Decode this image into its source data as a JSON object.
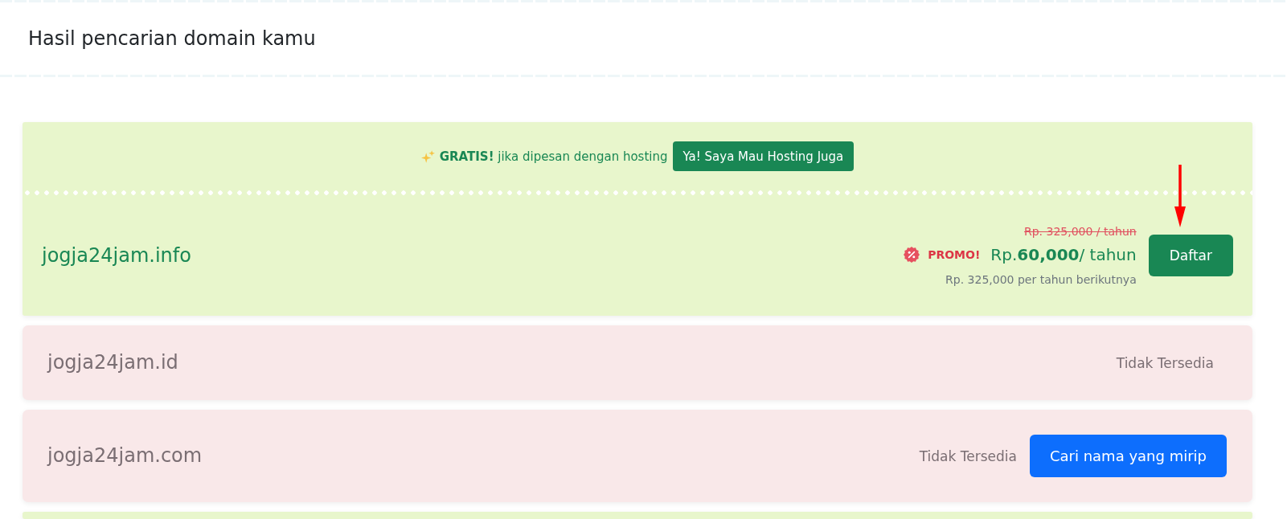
{
  "header": {
    "title": "Hasil pencarian domain kamu"
  },
  "results": [
    {
      "kind": "available",
      "promo": {
        "text": "**GRATIS!** jika dipesan dengan hosting",
        "button": "Ya! Saya Mau Hosting Juga"
      },
      "domain": "jogja24jam.info",
      "price": {
        "original": "Rp. 325,000 / tahun",
        "badge": "PROMO!",
        "current": "Rp.**60,000**/ tahun",
        "renewal": "Rp. 325,000 per tahun berikutnya"
      },
      "button": "Daftar"
    },
    {
      "kind": "unavailable",
      "domain": "jogja24jam.id",
      "status": "Tidak Tersedia"
    },
    {
      "kind": "unavailable",
      "domain": "jogja24jam.com",
      "status": "Tidak Tersedia",
      "button": "Cari nama yang mirip"
    },
    {
      "kind": "available"
    }
  ]
}
